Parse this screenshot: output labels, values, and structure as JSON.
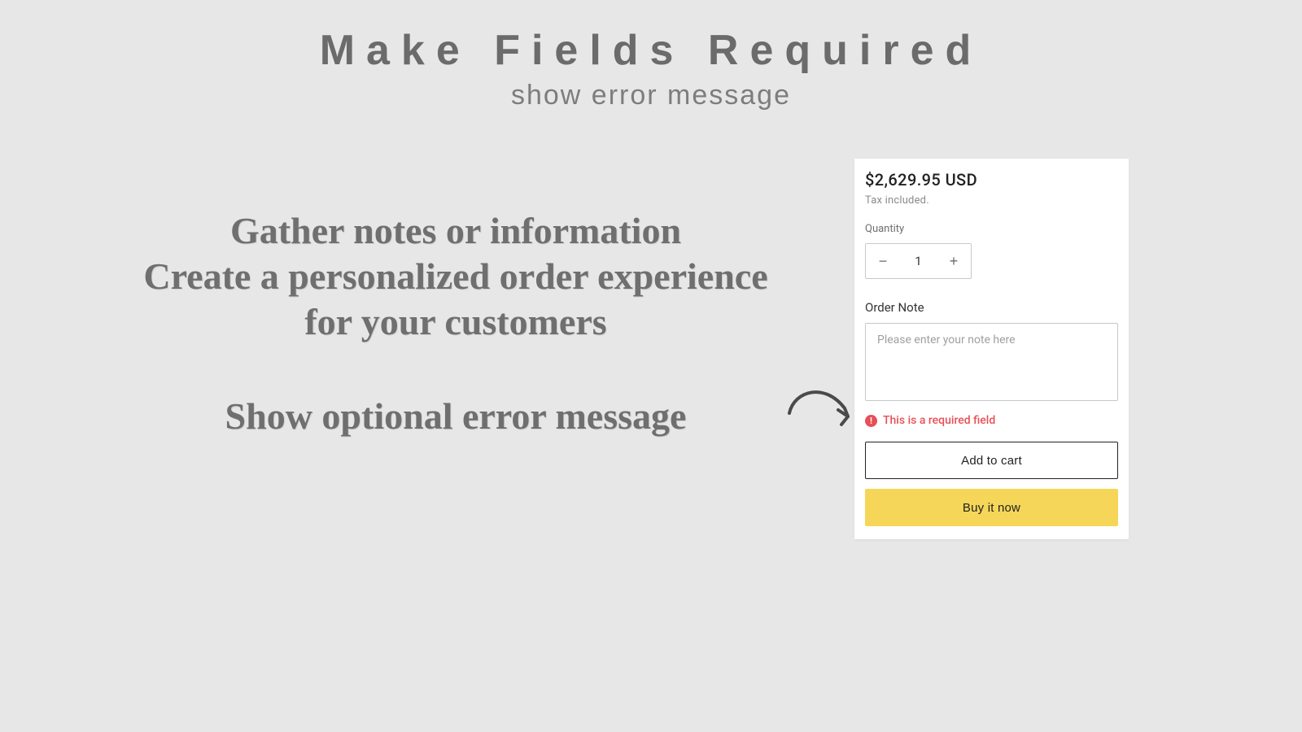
{
  "header": {
    "title": "Make Fields Required",
    "subtitle": "show error message"
  },
  "marketing": {
    "line1": "Gather notes or information",
    "line2": "Create a personalized order experience",
    "line3": "for your customers",
    "line4": "Show optional error message"
  },
  "card": {
    "price": "$2,629.95 USD",
    "tax_note": "Tax included.",
    "quantity_label": "Quantity",
    "quantity_value": "1",
    "order_note_label": "Order Note",
    "order_note_placeholder": "Please enter your note here",
    "error_message": "This is a required field",
    "add_to_cart_label": "Add to cart",
    "buy_now_label": "Buy it now"
  },
  "colors": {
    "page_bg": "#e7e7e7",
    "card_bg": "#ffffff",
    "primary_btn": "#f6d659",
    "error": "#e94f56",
    "text_muted": "#6f6f6f"
  }
}
